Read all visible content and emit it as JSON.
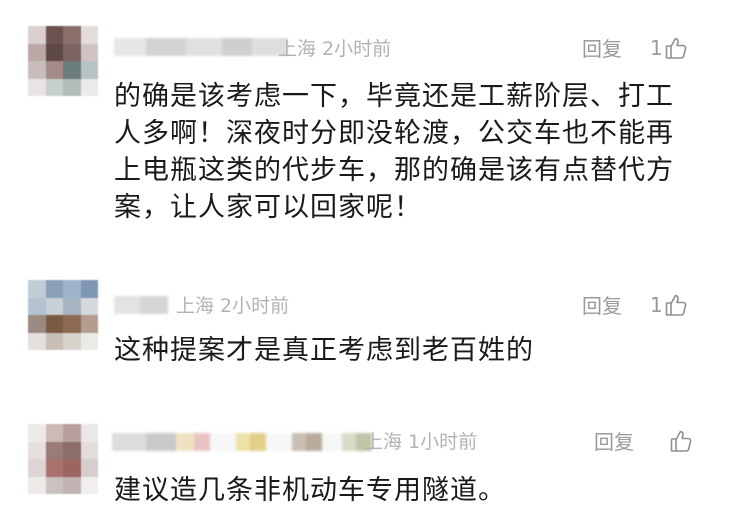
{
  "comments": [
    {
      "location": "上海",
      "time": "2小时前",
      "reply_label": "回复",
      "like_count": "1",
      "text": "的确是该考虑一下，毕竟还是工薪阶层、打工\n人多啊！深夜时分即没轮渡，公交车也不能再\n上电瓶这类的代步车，那的确是该有点替代方\n案，让人家可以回家呢！"
    },
    {
      "location": "上海",
      "time": "2小时前",
      "reply_label": "回复",
      "like_count": "1",
      "text": "这种提案才是真正考虑到老百姓的"
    },
    {
      "location": "上海",
      "time": "1小时前",
      "reply_label": "回复",
      "like_count": "",
      "text": "建议造几条非机动车专用隧道。"
    }
  ],
  "icons": {
    "like": "thumbs-up-icon",
    "avatar": "blurred-avatar"
  },
  "colors": {
    "text": "#1a1a1a",
    "meta": "#b3b3b3",
    "action": "#9a9a9a"
  }
}
